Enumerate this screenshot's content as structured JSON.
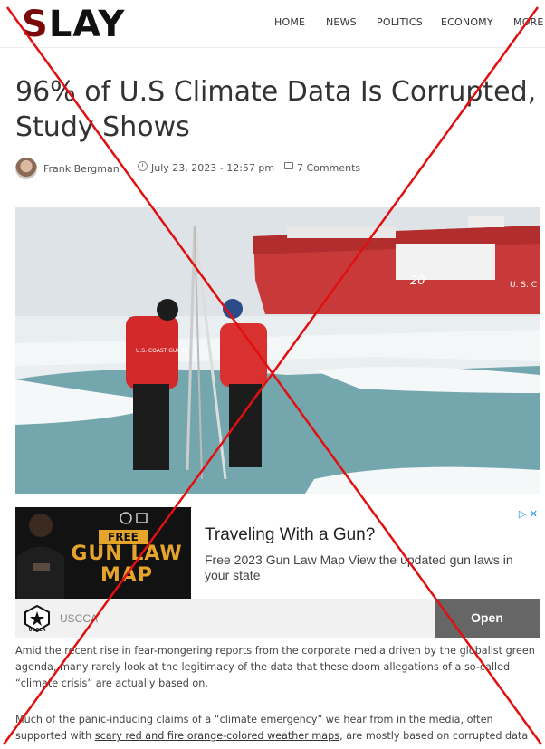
{
  "site": {
    "logo_first": "S",
    "logo_rest": "LAY"
  },
  "nav": [
    "HOME",
    "NEWS",
    "POLITICS",
    "ECONOMY",
    "MORE"
  ],
  "article": {
    "title": "96% of U.S Climate Data Is Corrupted, Study Shows",
    "author": "Frank Bergman",
    "date": "July 23, 2023 - 12:57 pm",
    "comments": "7 Comments",
    "paragraph1": "Amid the recent rise in fear-mongering reports from the corporate media driven by the globalist green agenda, many rarely look at the legitimacy of the data that these doom allegations of a so-called “climate crisis” are actually based on.",
    "paragraph2_start": "Much of the panic-inducing claims of a “climate emergency” we hear from in the media, often supported with ",
    "paragraph2_link": "scary red and fire orange-colored weather maps",
    "paragraph2_end": ", are mostly based on corrupted data"
  },
  "hero": {
    "ship_numbers": "20",
    "ship_markings": "U. S. C",
    "jacket_text": "U.S. COAST GUARD"
  },
  "ad": {
    "free_badge": "FREE",
    "image_line1": "GUN LAW",
    "image_line2": "MAP",
    "headline": "Traveling With a Gun?",
    "body": "Free 2023 Gun Law Map View the updated gun laws in your state",
    "brand": "USCCA",
    "logo_text": "USCCA",
    "open_label": "Open",
    "choices": "▷ ✕"
  },
  "colors": {
    "logo_accent": "#7a0a0a",
    "cross": "#e01010",
    "ad_gold": "#e4a52a",
    "ad_button": "#666666"
  },
  "icons": [
    "clock-icon",
    "comment-icon",
    "ad-choices-icon",
    "chevron-down-icon"
  ]
}
